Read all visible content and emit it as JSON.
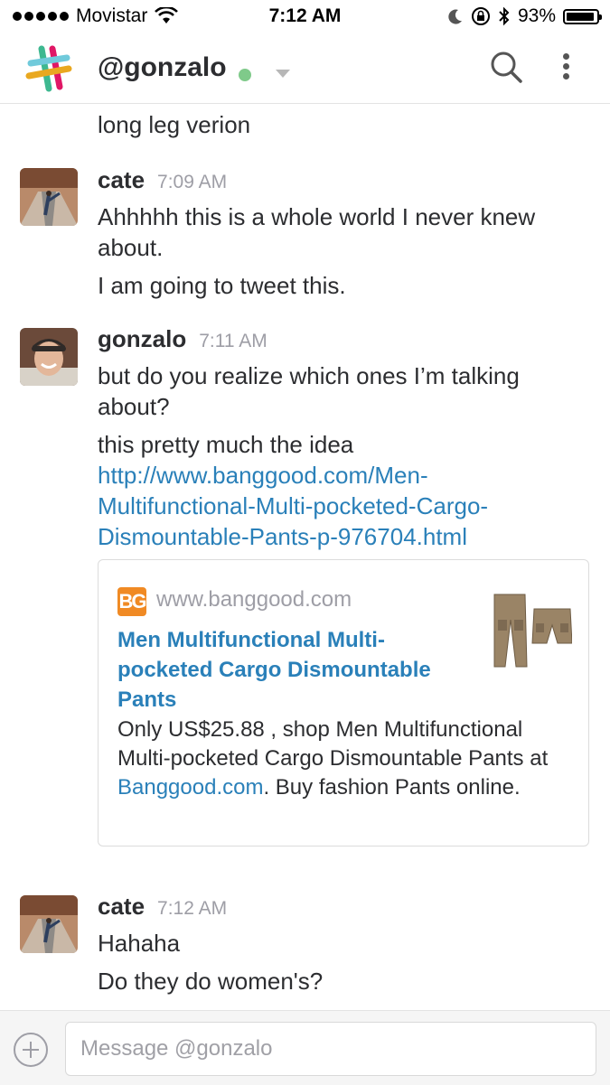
{
  "status_bar": {
    "carrier": "Movistar",
    "time": "7:12 AM",
    "battery": "93%",
    "battery_level": 0.93
  },
  "header": {
    "title": "@gonzalo"
  },
  "messages": [
    {
      "id": "prev",
      "lines": [
        "long leg verion"
      ]
    },
    {
      "sender": "cate",
      "time": "7:09 AM",
      "lines": [
        "Ahhhhh this is a whole world I never knew about.",
        "I am going to tweet this."
      ]
    },
    {
      "sender": "gonzalo",
      "time": "7:11 AM",
      "line1": "but do you realize which ones I’m talking about?",
      "line2_text": "this pretty much the idea ",
      "line2_link": "http://www.banggood.com/Men-Multifunctional-Multi-pocketed-Cargo-Dismountable-Pants-p-976704.html"
    },
    {
      "sender": "cate",
      "time": "7:12 AM",
      "lines": [
        "Hahaha",
        "Do they do women's?"
      ]
    }
  ],
  "attachment": {
    "icon_text": "BG",
    "domain": "www.banggood.com",
    "title": "Men Multifunctional Multi-pocketed Cargo Dismountable Pants",
    "desc_before": "Only US$25.88 , shop Men Multifunctional Multi-pocketed Cargo Dismountable Pants at ",
    "desc_link": "Banggood.com",
    "desc_after": ". Buy fashion Pants online."
  },
  "composer": {
    "placeholder": "Message @gonzalo"
  },
  "colors": {
    "link": "#2a80b9",
    "presence": "#7fca8a",
    "brand_orange": "#f08a24"
  }
}
